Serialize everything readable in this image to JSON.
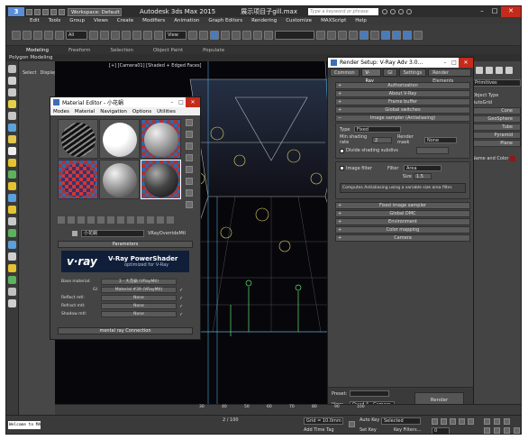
{
  "titlebar": {
    "logo": "3",
    "workspace": "Workspace: Default",
    "title": "Autodesk 3ds Max 2015",
    "file": "展示项目子gill.max",
    "search_placeholder": "Type a keyword or phrase"
  },
  "menubar": [
    "Edit",
    "Tools",
    "Group",
    "Views",
    "Create",
    "Modifiers",
    "Animation",
    "Graph Editors",
    "Rendering",
    "Customize",
    "MAXScript",
    "Help"
  ],
  "toolbar": {
    "selection_filter": "All",
    "view_ref": "View"
  },
  "ribbon": {
    "tabs": [
      "Modeling",
      "Freeform",
      "Selection",
      "Object Paint",
      "Populate"
    ],
    "sub_label": "Polygon Modeling"
  },
  "explorer": {
    "select_label": "Select",
    "display_label": "Display"
  },
  "viewport": {
    "label": "[+] [Camera01] [Shaded + Edged Faces]"
  },
  "material_editor": {
    "title": "Material Editor - 小花蜗",
    "menus": [
      "Modes",
      "Material",
      "Navigation",
      "Options",
      "Utilities"
    ],
    "material_name": "小花蜗",
    "material_type": "VRayOverrideMtl",
    "parameters_header": "Parameters",
    "banner_logo": "v·ray",
    "banner_title": "V-Ray PowerShader",
    "banner_sub": "optimized for V-Ray",
    "rows": [
      {
        "label": "Base material:",
        "value": "3 - 大花蜗 (VRayMtl)"
      },
      {
        "label": "GI",
        "value": "Material #39 (VRayMtl)"
      },
      {
        "label": "Reflect mtl:",
        "value": "None"
      },
      {
        "label": "Refract mtl:",
        "value": "None"
      },
      {
        "label": "Shadow mtl:",
        "value": "None"
      }
    ],
    "connection_header": "mental ray Connection"
  },
  "render_setup": {
    "title": "Render Setup: V-Ray Adv 3.0...",
    "tabs": [
      "Common",
      "V-Ray",
      "GI",
      "Settings",
      "Render Elements"
    ],
    "rollouts_top": [
      "Authorization",
      "About V-Ray",
      "Frame buffer",
      "Global switches"
    ],
    "aa_header": "Image sampler (Antialiasing)",
    "aa_type_label": "Type",
    "aa_type_value": "Fixed",
    "min_shading_label": "Min shading rate",
    "min_shading_value": "2",
    "render_mask_label": "Render mask",
    "render_mask_value": "None",
    "divide_shading_label": "Divide shading subdivs",
    "filter_label": "Image filter",
    "filter_field_label": "Filter",
    "filter_value": "Area",
    "size_label": "Size",
    "size_value": "1.5",
    "filter_desc": "Computes Antialiasing using a variable size area filter.",
    "rollouts_bottom": [
      "Fixed image sampler",
      "Global DMC",
      "Environment",
      "Color mapping",
      "Camera"
    ],
    "preset_label": "Preset:",
    "view_label": "View:",
    "view_value": "Quad 4 - Camera",
    "render_button": "Render"
  },
  "command_panel": {
    "dropdown": "Primitives",
    "object_type": "Object Type",
    "autogrid": "AutoGrid",
    "buttons": [
      "Cone",
      "GeoSphere",
      "Tube",
      "Pyramid",
      "Plane"
    ],
    "name_color": "Name and Color"
  },
  "timeline": {
    "ticks": [
      "30",
      "40",
      "50",
      "60",
      "70",
      "80",
      "90",
      "100"
    ]
  },
  "statusbar": {
    "welcome": "Welcome to MAX",
    "grid": "Grid = 10.0mm",
    "add_time_tag": "Add Time Tag",
    "autokey": "Auto Key",
    "selected": "Selected",
    "setkey": "Set Key",
    "key_filters": "Key Filters...",
    "frame": "0",
    "total": "2 / 100"
  },
  "colors": {
    "accent": "#4a7ab8",
    "close": "#c42b1c",
    "vray_bg": "#101e3a"
  }
}
